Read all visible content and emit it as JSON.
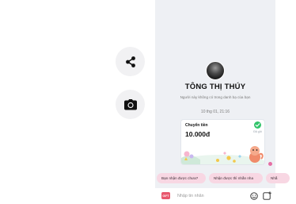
{
  "left_panel": {
    "actions": [
      {
        "name": "share",
        "icon": "share-icon"
      },
      {
        "name": "camera",
        "icon": "camera-icon"
      }
    ]
  },
  "contact": {
    "name": "TÔNG THỊ THÚY",
    "subtitle": "Người này không có trong danh bạ của bạn",
    "avatar_icon": "avatar-photo"
  },
  "conversation": {
    "timestamp": "10 thg 01, 21:16",
    "transfer": {
      "title": "Chuyển tiền",
      "amount": "10.000đ",
      "status": "Đã gửi",
      "status_color": "#33c46b"
    }
  },
  "quick_replies": [
    "Bạn nhận được chưa?",
    "Nhận được thì nhắn nha",
    "Nhắ"
  ],
  "composer": {
    "placeholder": "Nhập tin nhắn",
    "gift_label": "GIFT",
    "accent_color": "#e8576d"
  },
  "colors": {
    "chat_background": "#eef0f4",
    "chip_background": "#f8d7e3",
    "card_border": "#e2e6ec"
  }
}
